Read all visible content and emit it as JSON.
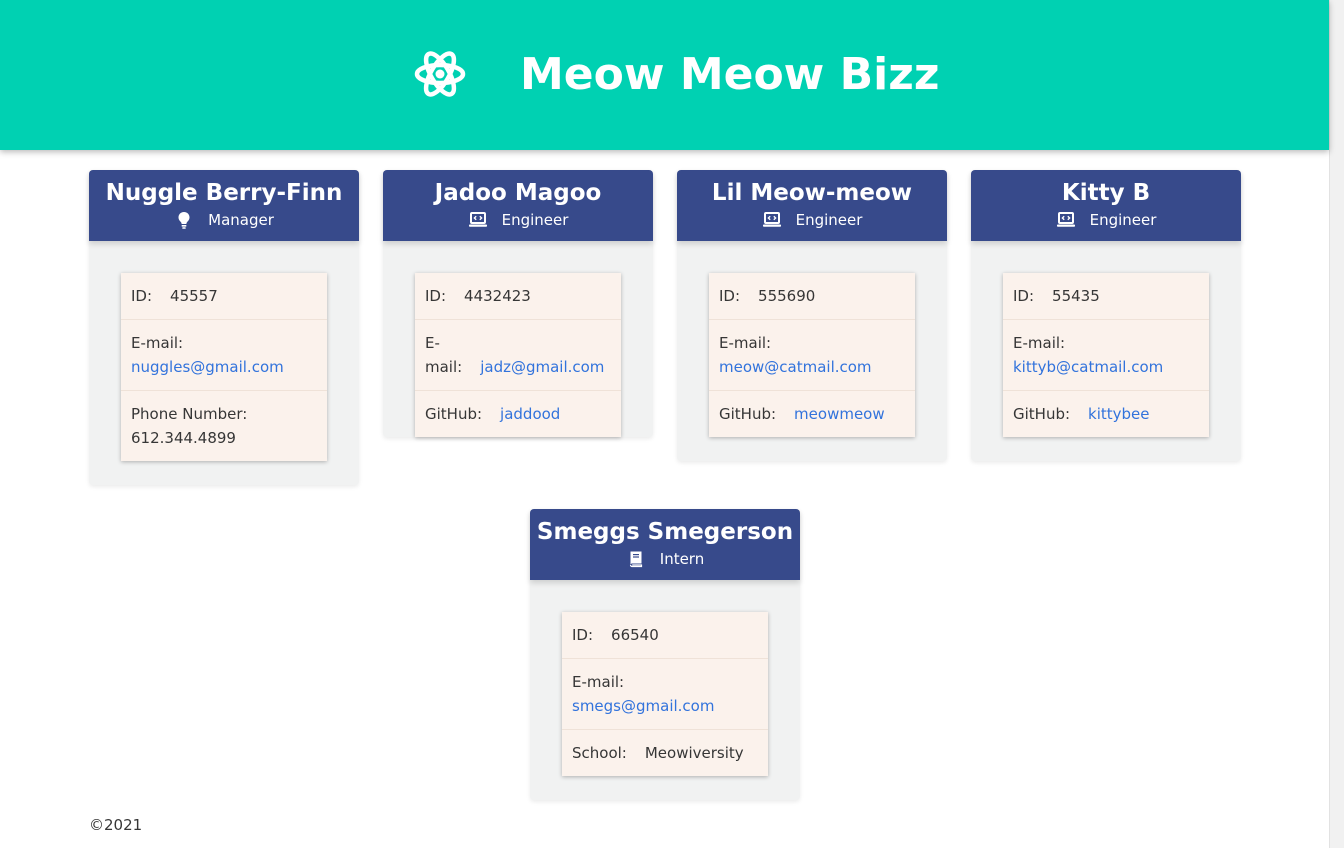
{
  "header": {
    "title": "Meow Meow Bizz",
    "logo_icon": "atom-icon",
    "background": "#00d1b2"
  },
  "colors": {
    "card_header": "#374a8b",
    "card_body": "#f1f2f2",
    "info_background": "#fbf2ec",
    "link": "#3273dc"
  },
  "employees": [
    {
      "name": "Nuggle Berry-Finn",
      "role": "Manager",
      "role_icon": "lightbulb-icon",
      "id_label": "ID:",
      "id": "45557",
      "email_label": "E-mail:",
      "email": "nuggles@gmail.com",
      "extra_label": "Phone Number:",
      "extra_value": "612.344.4899"
    },
    {
      "name": "Jadoo Magoo",
      "role": "Engineer",
      "role_icon": "laptop-code-icon",
      "id_label": "ID:",
      "id": "4432423",
      "email_label": "E-mail:",
      "email": "jadz@gmail.com",
      "extra_label": "GitHub:",
      "extra_value": "jaddood"
    },
    {
      "name": "Lil Meow-meow",
      "role": "Engineer",
      "role_icon": "laptop-code-icon",
      "id_label": "ID:",
      "id": "555690",
      "email_label": "E-mail:",
      "email": "meow@catmail.com",
      "extra_label": "GitHub:",
      "extra_value": "meowmeow"
    },
    {
      "name": "Kitty B",
      "role": "Engineer",
      "role_icon": "laptop-code-icon",
      "id_label": "ID:",
      "id": "55435",
      "email_label": "E-mail:",
      "email": "kittyb@catmail.com",
      "extra_label": "GitHub:",
      "extra_value": "kittybee"
    },
    {
      "name": "Smeggs Smegerson",
      "role": "Intern",
      "role_icon": "book-icon",
      "id_label": "ID:",
      "id": "66540",
      "email_label": "E-mail:",
      "email": "smegs@gmail.com",
      "extra_label": "School:",
      "extra_value": "Meowiversity"
    }
  ],
  "footer": {
    "copyright": "©2021"
  }
}
